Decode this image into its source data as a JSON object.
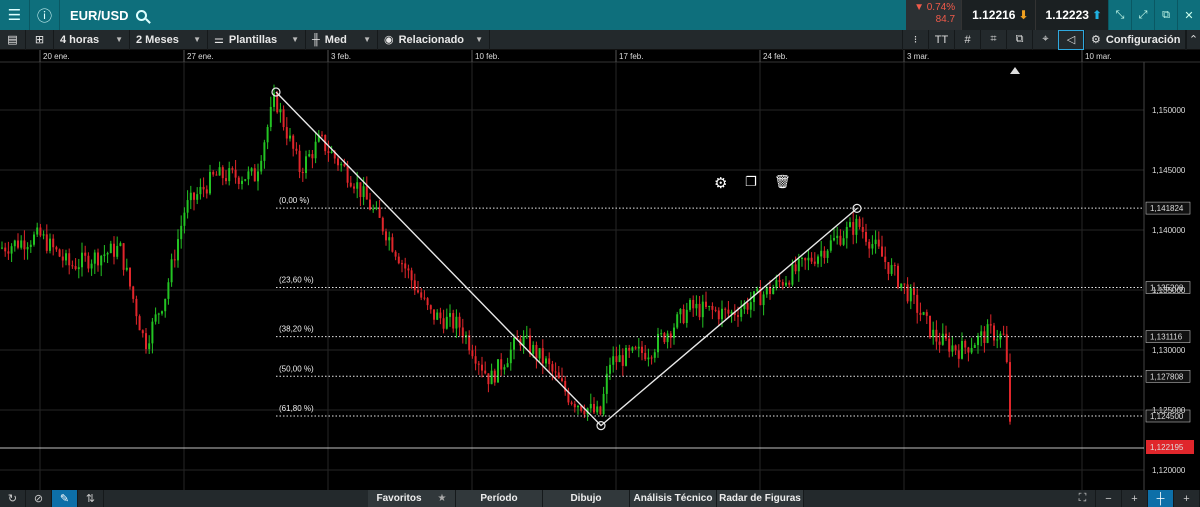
{
  "topbar": {
    "symbol": "EUR/USD",
    "change_pct": "▼ 0.74%",
    "change_pts": "84.7",
    "sell_price": "1.12216",
    "buy_price": "1.12223"
  },
  "toolbar": {
    "timeframe": "4 horas",
    "range": "2 Meses",
    "templates": "Plantillas",
    "chart_type": "Med",
    "related": "Relacionado",
    "settings": "Configuración"
  },
  "chart_data": {
    "type": "candlestick",
    "symbol": "EUR/USD",
    "x_labels": [
      "20 ene.",
      "27 ene.",
      "3 feb.",
      "10 feb.",
      "17 feb.",
      "24 feb.",
      "3 mar.",
      "10 mar."
    ],
    "y_ticks": [
      "1,150000",
      "1,145000",
      "1,140000",
      "1,135000",
      "1,130000",
      "1,125000",
      "1,120000"
    ],
    "ylim": [
      1.1185,
      1.1545
    ],
    "current_price": "1,122195",
    "fibonacci": [
      {
        "label": "(0,00 %)",
        "price": "1,141824"
      },
      {
        "label": "(23,60 %)",
        "price": "1,135208"
      },
      {
        "label": "(38,20 %)",
        "price": "1,131116"
      },
      {
        "label": "(50,00 %)",
        "price": "1,127808"
      },
      {
        "label": "(61,80 %)",
        "price": "1,124500"
      }
    ],
    "drawing_points": [
      {
        "date": "Jan 31",
        "price": 1.1515
      },
      {
        "date": "Feb 18",
        "price": 1.1237
      },
      {
        "date": "Feb 28",
        "price": 1.1418
      }
    ],
    "colors": {
      "up": "#23c423",
      "down": "#e0262b",
      "background": "#000000"
    }
  },
  "bottombar": {
    "favorites": "Favoritos",
    "period": "Período",
    "drawing": "Dibujo",
    "technical": "Análisis Técnico",
    "radar": "Radar de Figuras"
  }
}
